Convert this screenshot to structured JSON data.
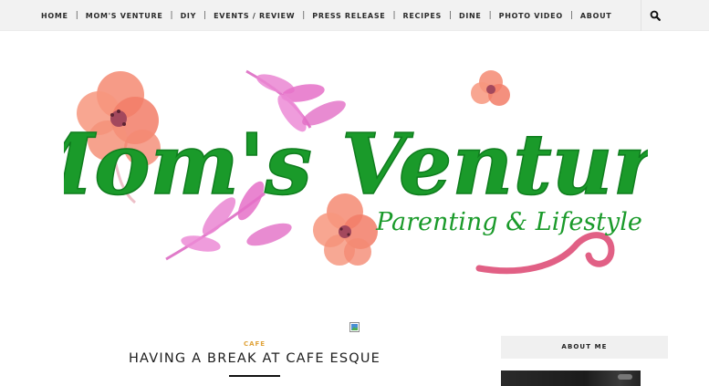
{
  "nav": {
    "items": [
      {
        "label": "HOME",
        "name": "nav-home"
      },
      {
        "label": "MOM'S VENTURE",
        "name": "nav-moms-venture"
      },
      {
        "label": "DIY",
        "name": "nav-diy"
      },
      {
        "label": "EVENTS / REVIEW",
        "name": "nav-events-review"
      },
      {
        "label": "PRESS RELEASE",
        "name": "nav-press-release"
      },
      {
        "label": "RECIPES",
        "name": "nav-recipes"
      },
      {
        "label": "DINE",
        "name": "nav-dine"
      },
      {
        "label": "PHOTO VIDEO",
        "name": "nav-photo-video"
      },
      {
        "label": "ABOUT",
        "name": "nav-about"
      }
    ],
    "separator": "|",
    "search_icon": "search-icon"
  },
  "header": {
    "logo_title": "Mom's Venture",
    "logo_tagline": "Parenting & Lifestyle",
    "colors": {
      "title_green": "#1a9a2a",
      "flower_coral": "#f3876f",
      "leaf_pink": "#e679c9",
      "swirl_pink": "#de4f78"
    }
  },
  "post": {
    "category": "CAFE",
    "title": "HAVING A BREAK AT CAFE ESQUE",
    "category_color": "#e0a33a"
  },
  "sidebar": {
    "about_title": "ABOUT ME"
  }
}
